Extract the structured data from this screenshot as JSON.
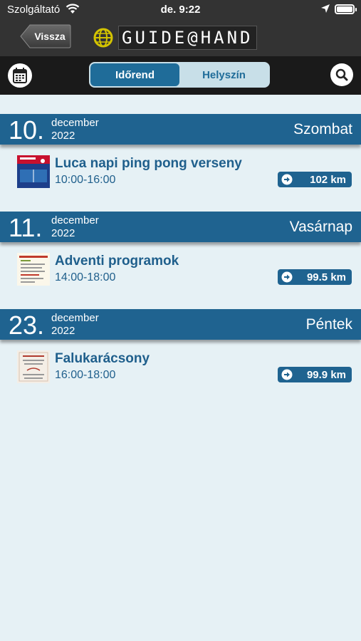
{
  "status": {
    "carrier": "Szolgáltató",
    "time": "de. 9:22"
  },
  "nav": {
    "back_label": "Vissza",
    "logo_text": "GUIDE@HAND"
  },
  "tabs": [
    {
      "label": "Időrend",
      "active": true
    },
    {
      "label": "Helyszín",
      "active": false
    }
  ],
  "days": [
    {
      "num": "10.",
      "month": "december",
      "year": "2022",
      "weekday": "Szombat",
      "events": [
        {
          "title": "Luca napi ping pong verseny",
          "time": "10:00-16:00",
          "distance": "102 km"
        }
      ]
    },
    {
      "num": "11.",
      "month": "december",
      "year": "2022",
      "weekday": "Vasárnap",
      "events": [
        {
          "title": "Adventi programok",
          "time": "14:00-18:00",
          "distance": "99.5 km"
        }
      ]
    },
    {
      "num": "23.",
      "month": "december",
      "year": "2022",
      "weekday": "Péntek",
      "events": [
        {
          "title": "Falukarácsony",
          "time": "16:00-18:00",
          "distance": "99.9 km"
        }
      ]
    }
  ],
  "colors": {
    "accent": "#1f6390",
    "background": "#e6f1f5",
    "header": "#333333"
  },
  "icons": [
    "wifi-icon",
    "location-arrow-icon",
    "battery-icon",
    "globe-icon",
    "calendar-icon",
    "search-icon",
    "arrow-right-icon"
  ]
}
